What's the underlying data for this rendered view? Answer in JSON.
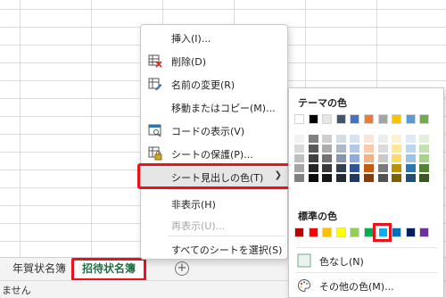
{
  "sheet_tabs": [
    "年賀状名簿",
    "招待状名簿"
  ],
  "status_text": "ません",
  "context_menu": {
    "items": [
      {
        "label": "挿入(I)...",
        "icon": "none",
        "disabled": false
      },
      {
        "label": "削除(D)",
        "icon": "delete-sheet-icon",
        "disabled": false
      },
      {
        "label": "名前の変更(R)",
        "icon": "rename-sheet-icon",
        "disabled": false
      },
      {
        "label": "移動またはコピー(M)...",
        "icon": "none",
        "disabled": false
      },
      {
        "label": "コードの表示(V)",
        "icon": "view-code-icon",
        "disabled": false
      },
      {
        "label": "シートの保護(P)...",
        "icon": "protect-sheet-icon",
        "disabled": false
      },
      {
        "label": "シート見出しの色(T)",
        "icon": "none",
        "disabled": false
      },
      {
        "label": "非表示(H)",
        "icon": "none",
        "disabled": false
      },
      {
        "label": "再表示(U)...",
        "icon": "none",
        "disabled": true
      },
      {
        "label": "すべてのシートを選択(S)",
        "icon": "none",
        "disabled": false
      }
    ]
  },
  "color_picker": {
    "theme_heading": "テーマの色",
    "standard_heading": "標準の色",
    "no_color_label": "色なし(N)",
    "more_colors_label": "その他の色(M)...",
    "theme_colors": [
      "#ffffff",
      "#000000",
      "#e7e6e6",
      "#44546a",
      "#4472c4",
      "#ed7d31",
      "#a5a5a5",
      "#ffc000",
      "#5b9bd5",
      "#70ad47"
    ],
    "theme_shades": [
      [
        "#f2f2f2",
        "#d9d9d9",
        "#bfbfbf",
        "#a6a6a6",
        "#808080"
      ],
      [
        "#808080",
        "#595959",
        "#404040",
        "#262626",
        "#0d0d0d"
      ],
      [
        "#d0cece",
        "#aeabab",
        "#757171",
        "#3a3838",
        "#171616"
      ],
      [
        "#d6dce4",
        "#adb9ca",
        "#8496b0",
        "#323f4f",
        "#222a35"
      ],
      [
        "#d9e2f3",
        "#b4c7e7",
        "#8faadc",
        "#2f5597",
        "#1f3864"
      ],
      [
        "#fbe5d6",
        "#f8cbad",
        "#f4b183",
        "#c55a11",
        "#843c0c"
      ],
      [
        "#ededed",
        "#dbdbdb",
        "#c9c9c9",
        "#7b7b7b",
        "#525252"
      ],
      [
        "#fff2cc",
        "#ffe699",
        "#ffd966",
        "#bf9000",
        "#7f6000"
      ],
      [
        "#deebf7",
        "#bdd7ee",
        "#9dc3e6",
        "#2e75b6",
        "#1f4e79"
      ],
      [
        "#e2f0d9",
        "#c5e0b4",
        "#a9d18e",
        "#548235",
        "#385723"
      ]
    ],
    "standard_colors": [
      "#c00000",
      "#ff0000",
      "#ffc000",
      "#ffff00",
      "#92d050",
      "#00b050",
      "#00b0f0",
      "#0070c0",
      "#002060",
      "#7030a0"
    ],
    "selected_standard_index": 6
  },
  "accent": {
    "highlight": "#e8141c",
    "active_tab_text": "#1e7145"
  }
}
